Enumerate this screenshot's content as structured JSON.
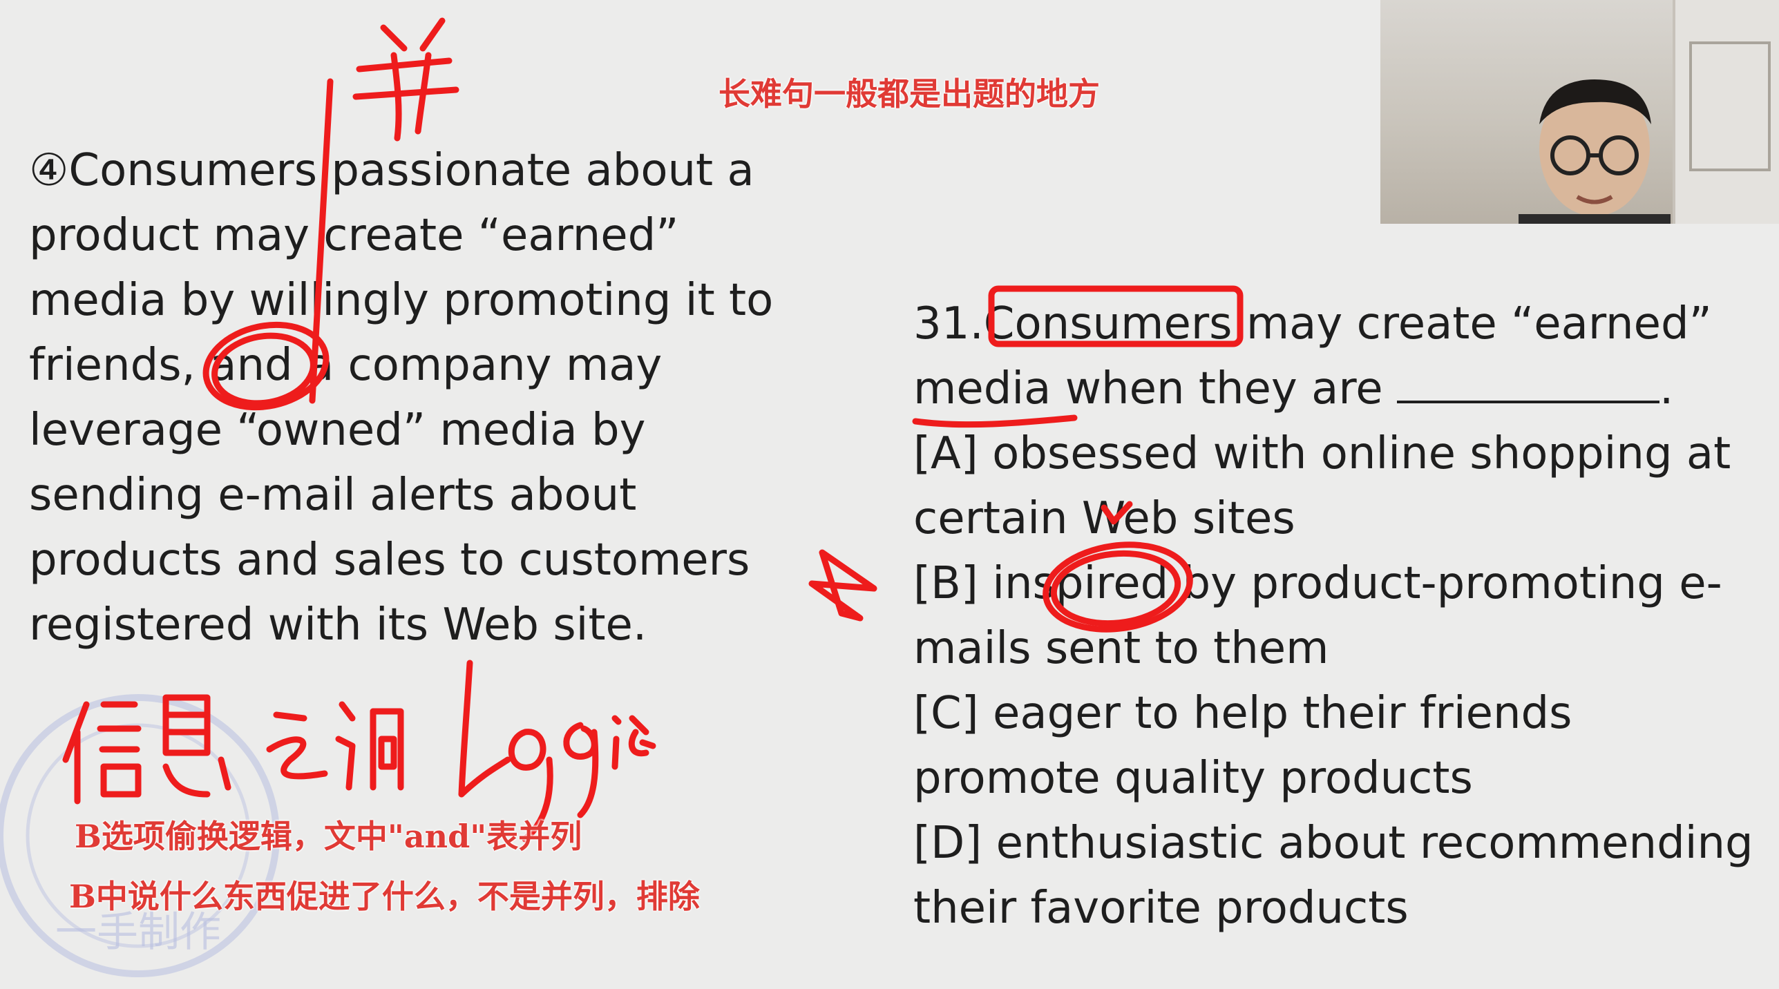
{
  "top_caption": "长难句一般都是出题的地方",
  "passage": {
    "lines": [
      "④Consumers passionate about a",
      "product may create “earned”",
      "media by willingly promoting it to",
      "friends, and a company may",
      "leverage “owned” media by",
      "sending e-mail alerts about",
      "products and sales to customers",
      "registered  with its Web site."
    ]
  },
  "question": {
    "stem_line1": "31.Consumers may create “earned”",
    "stem_line2": "media when they are",
    "stem_end": ".",
    "options": {
      "A_line1": " [A] obsessed with online shopping at",
      "A_line2": "certain Web sites",
      "B_line1": " [B] inspired by product-promoting e-",
      "B_line2": "mails sent to them",
      "C_line1": " [C] eager to help their friends",
      "C_line2": "promote quality products",
      "D_line1": " [D] enthusiastic about recommending",
      "D_line2": "their favorite products"
    }
  },
  "handwriting": {
    "top_note": "并",
    "bottom_note": "信息 之间 logic"
  },
  "subtitles": {
    "line1": "B选项偷换逻辑，文中\"and\"表并列",
    "line2": "B中说什么东西促进了什么，不是并列，排除"
  },
  "colors": {
    "ink": "#ee1c1c",
    "caption": "#e03a35",
    "text": "#1e1e1e"
  }
}
